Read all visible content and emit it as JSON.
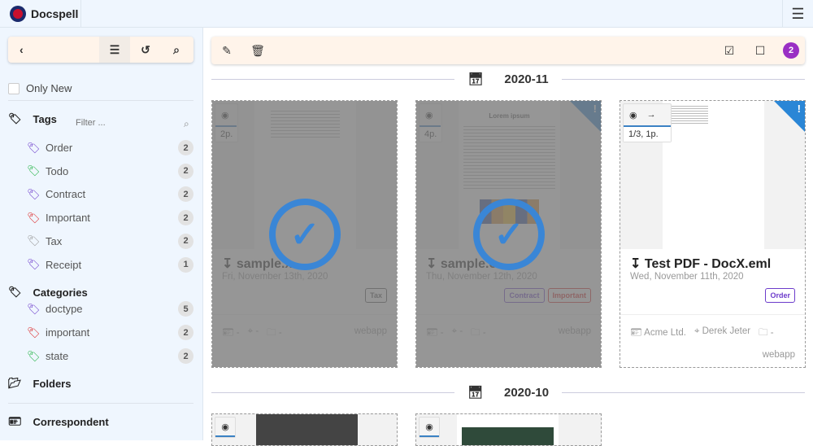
{
  "app": {
    "title": "Docspell",
    "menu_icon": "hamburger-icon"
  },
  "sidebar": {
    "only_new": "Only New",
    "tags_title": "Tags",
    "filter_placeholder": "Filter ...",
    "tags": [
      {
        "label": "Order",
        "count": "2",
        "color": "#6d3ccb"
      },
      {
        "label": "Todo",
        "count": "2",
        "color": "#22b345"
      },
      {
        "label": "Contract",
        "count": "2",
        "color": "#6d3ccb"
      },
      {
        "label": "Important",
        "count": "2",
        "color": "#dc2626"
      },
      {
        "label": "Tax",
        "count": "2",
        "color": "#999999"
      },
      {
        "label": "Receipt",
        "count": "1",
        "color": "#6d3ccb"
      }
    ],
    "categories_title": "Categories",
    "categories": [
      {
        "label": "doctype",
        "count": "5",
        "color": "#6d3ccb"
      },
      {
        "label": "important",
        "count": "2",
        "color": "#dc2626"
      },
      {
        "label": "state",
        "count": "2",
        "color": "#22b345"
      }
    ],
    "folders_title": "Folders",
    "correspondent_title": "Correspondent"
  },
  "toolbar": {
    "selected_count": "2"
  },
  "groups": [
    {
      "label": "2020-11"
    },
    {
      "label": "2020-10"
    }
  ],
  "cards": [
    {
      "pages": "2p.",
      "title": "sample.xlsx",
      "title_visible": "sample.x",
      "date": "Fri, November 13th, 2020",
      "tags": [
        "Tax"
      ],
      "correspondent": "-",
      "concerning": "-",
      "folder": "-",
      "source": "webapp",
      "selected": true
    },
    {
      "pages": "4p.",
      "title": "sample.odt",
      "title_visible": "sample.o",
      "date": "Thu, November 12th, 2020",
      "tags": [
        "Contract",
        "Important"
      ],
      "correspondent": "-",
      "concerning": "-",
      "folder": "-",
      "source": "webapp",
      "selected": true,
      "preview_heading": "Lorem ipsum"
    },
    {
      "pages": "1/3, 1p.",
      "title": "Test PDF - DocX.eml",
      "date": "Wed, November 11th, 2020",
      "tags": [
        "Order"
      ],
      "correspondent": "Acme Ltd.",
      "concerning": "Derek Jeter",
      "folder": "-",
      "source": "webapp",
      "selected": false
    }
  ]
}
